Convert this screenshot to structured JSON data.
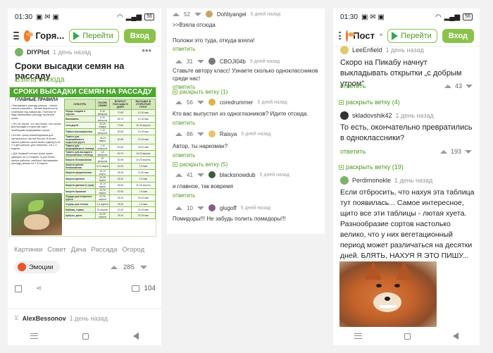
{
  "left": {
    "status_time": "01:30",
    "battery": "56",
    "header": {
      "title": "Горя...",
      "go_label": "Перейти",
      "login_label": "Вход"
    },
    "post": {
      "author": "DIYPlot",
      "time": "1 день назад",
      "title": "Сроки высадки семян на рассаду",
      "source_link": "Взяла отсюда",
      "image": {
        "heading": "СРОКИ ВЫСАДКИ СЕМЯН НА РАССАДУ",
        "rules_title": "ГЛАВНЫЕ ПРАВИЛА",
        "rules": [
          "• Высаживать рассаду раньше - значит сильно рисковать - велика вероятность погибания под заморозки. Поэтому не надо высаживать рассаду на ранние сроки.",
          "• Это не значит, что чем позже, тем лучше. Для высадки в открытый грунт необходимо выдерживать сроки.",
          "• Кстати, сроки рекомендованы для Центральных частей России. В более южных районах сроки можно сдвинуть на 2-4 дня раньше, для северных - на 2-3 недели.",
          "• Для Средней полосы сроки нужно сдвинуть на 3-4 недели. А для более южных районов, наоборот, высаживают рассаду раньше на 2-3 недели."
        ],
        "columns": [
          "КУЛЬТУРА",
          "ПОСЕВ СЕМЯН",
          "ВОЗРАСТ РАССАДЫ В ДНЯХ",
          "ВЫСАДКА В ОТКРЫТЫЙ ГРУНТ"
        ],
        "rows": [
          [
            "Перцы сладкие и горькие",
            "5-15 февраля",
            "70-80",
            "10-15 мая"
          ],
          [
            "Баклажаны",
            "5-15 февраля",
            "65-70",
            "10-15 мая"
          ],
          [
            "Сельдерей",
            "20-30 января",
            "70-80",
            "20-25 апреля"
          ],
          [
            "Томаты высокорослые",
            "1-10 февраля",
            "60-65",
            "10-15 мая"
          ],
          [
            "Томаты для выращивания в открытом грунте",
            "15-20 марта",
            "50-55",
            "10-15 мая"
          ],
          [
            "Томаты для выращивания в теплице",
            "1-10 февраля",
            "60-65",
            "15-20 мая"
          ],
          [
            "Томаты для высадки в обогреваемые теплицы",
            "1-5 февраля",
            "60-70",
            "15-20 апреля"
          ],
          [
            "Капуста белокочанная",
            "25 февраля",
            "50-55",
            "20-25 апреля"
          ],
          [
            "Капуста ранняя белокочанная",
            "5-10 марта",
            "40-45",
            "1-5 мая"
          ],
          [
            "Капуста среднеспелая",
            "10-15 марта",
            "35-45",
            "10-20 мая"
          ],
          [
            "Капуста цветная",
            "20-25 марта",
            "35-40",
            "1-5 мая"
          ],
          [
            "Капуста цветная (1 срок)",
            "10-15 марта",
            "45-50",
            "20-25 апреля"
          ],
          [
            "Капуста брокколи",
            "10-20 марта",
            "40-45",
            "1-5 мая"
          ],
          [
            "Огурцы для открытого грунта",
            "20-25 апреля",
            "25-30",
            "20-25 мая"
          ],
          [
            "Огурцы для теплиц",
            "1-5 апреля",
            "25-30",
            "1-5 мая"
          ],
          [
            "Кабачки, тыквы",
            "25 апреля",
            "20-25",
            "20-25 мая"
          ],
          [
            "Арбузы, дыни",
            "20-25 апреля",
            "25-30",
            "20-25 мая"
          ]
        ]
      },
      "tags": [
        "Картинки",
        "Совет",
        "Дача",
        "Рассада",
        "Огород"
      ],
      "emotion_label": "Эмоции",
      "rating": "285",
      "comments_count": "104"
    },
    "next_author": "AlexBessonov",
    "next_time": "1 день назад"
  },
  "middle": {
    "comments": [
      {
        "votes": "52",
        "author": "Dohliyangel",
        "time": "5 дней назад",
        "text": ">>Взяла отсюда",
        "text2": "Положи это туда, откуда взяла!",
        "reply": "ответить"
      },
      {
        "votes": "31",
        "author": "CBOJI04b",
        "time": "5 дней назад",
        "text": "Ставьте автору класс! Узнаете сколько одноклассников среди нас!",
        "reply": "ответить"
      },
      {
        "expand": "раскрыть ветку (1)"
      },
      {
        "votes": "56",
        "author": "coredrummer",
        "time": "5 дней назад",
        "text": "Кто вас выпустил из одноглазников? Идите отсюда.",
        "reply": "ответить"
      },
      {
        "votes": "86",
        "author": "Raisya",
        "time": "5 дней назад",
        "text": "Автор, ты наркоман?",
        "reply": "ответить"
      },
      {
        "expand": "раскрыть ветку (5)"
      },
      {
        "votes": "41",
        "author": "blacksnowdub",
        "time": "5 дней назад",
        "text": "и главное, так вовремя",
        "reply": "ответить"
      },
      {
        "votes": "10",
        "author": "glugoff",
        "time": "5 дней назад",
        "text": "Помидоры!!! Не забудь полить помидоры!!!"
      }
    ]
  },
  "right": {
    "status_time": "01:30",
    "battery": "56",
    "header": {
      "title": "Пост",
      "go_label": "Перейти",
      "login_label": "Вход"
    },
    "comments": [
      {
        "author": "LeeEnfield",
        "time": "1 день назад",
        "text": "Скоро на Пикабу начнут выкладывать открытки „с добрым утром\"",
        "reply": "ответить",
        "votes": "43"
      },
      {
        "expand": "раскрыть ветку (4)"
      },
      {
        "author": "skladovshik42",
        "time": "1 день назад",
        "text": "То есть, окончательно превратились в одноклассники?",
        "reply": "ответить",
        "votes": "193"
      },
      {
        "expand": "раскрыть ветку (19)"
      },
      {
        "author": "Perdimonokle",
        "time": "1 день назад",
        "text": "Если отбросить, что нахуя эта таблица тут появилась... Самое интересное, щито все эти таблицы - лютая хуета. Разнообразие сортов настолько велико, что у них вегетационный период может различаться на десятки дней. БЛЯТЬ, НАХУЯ Я ЭТО ПИШУ..."
      }
    ]
  },
  "colors": {
    "accent": "#8ac34a",
    "link": "#4a9a1e",
    "brand": "#f07b2a"
  }
}
